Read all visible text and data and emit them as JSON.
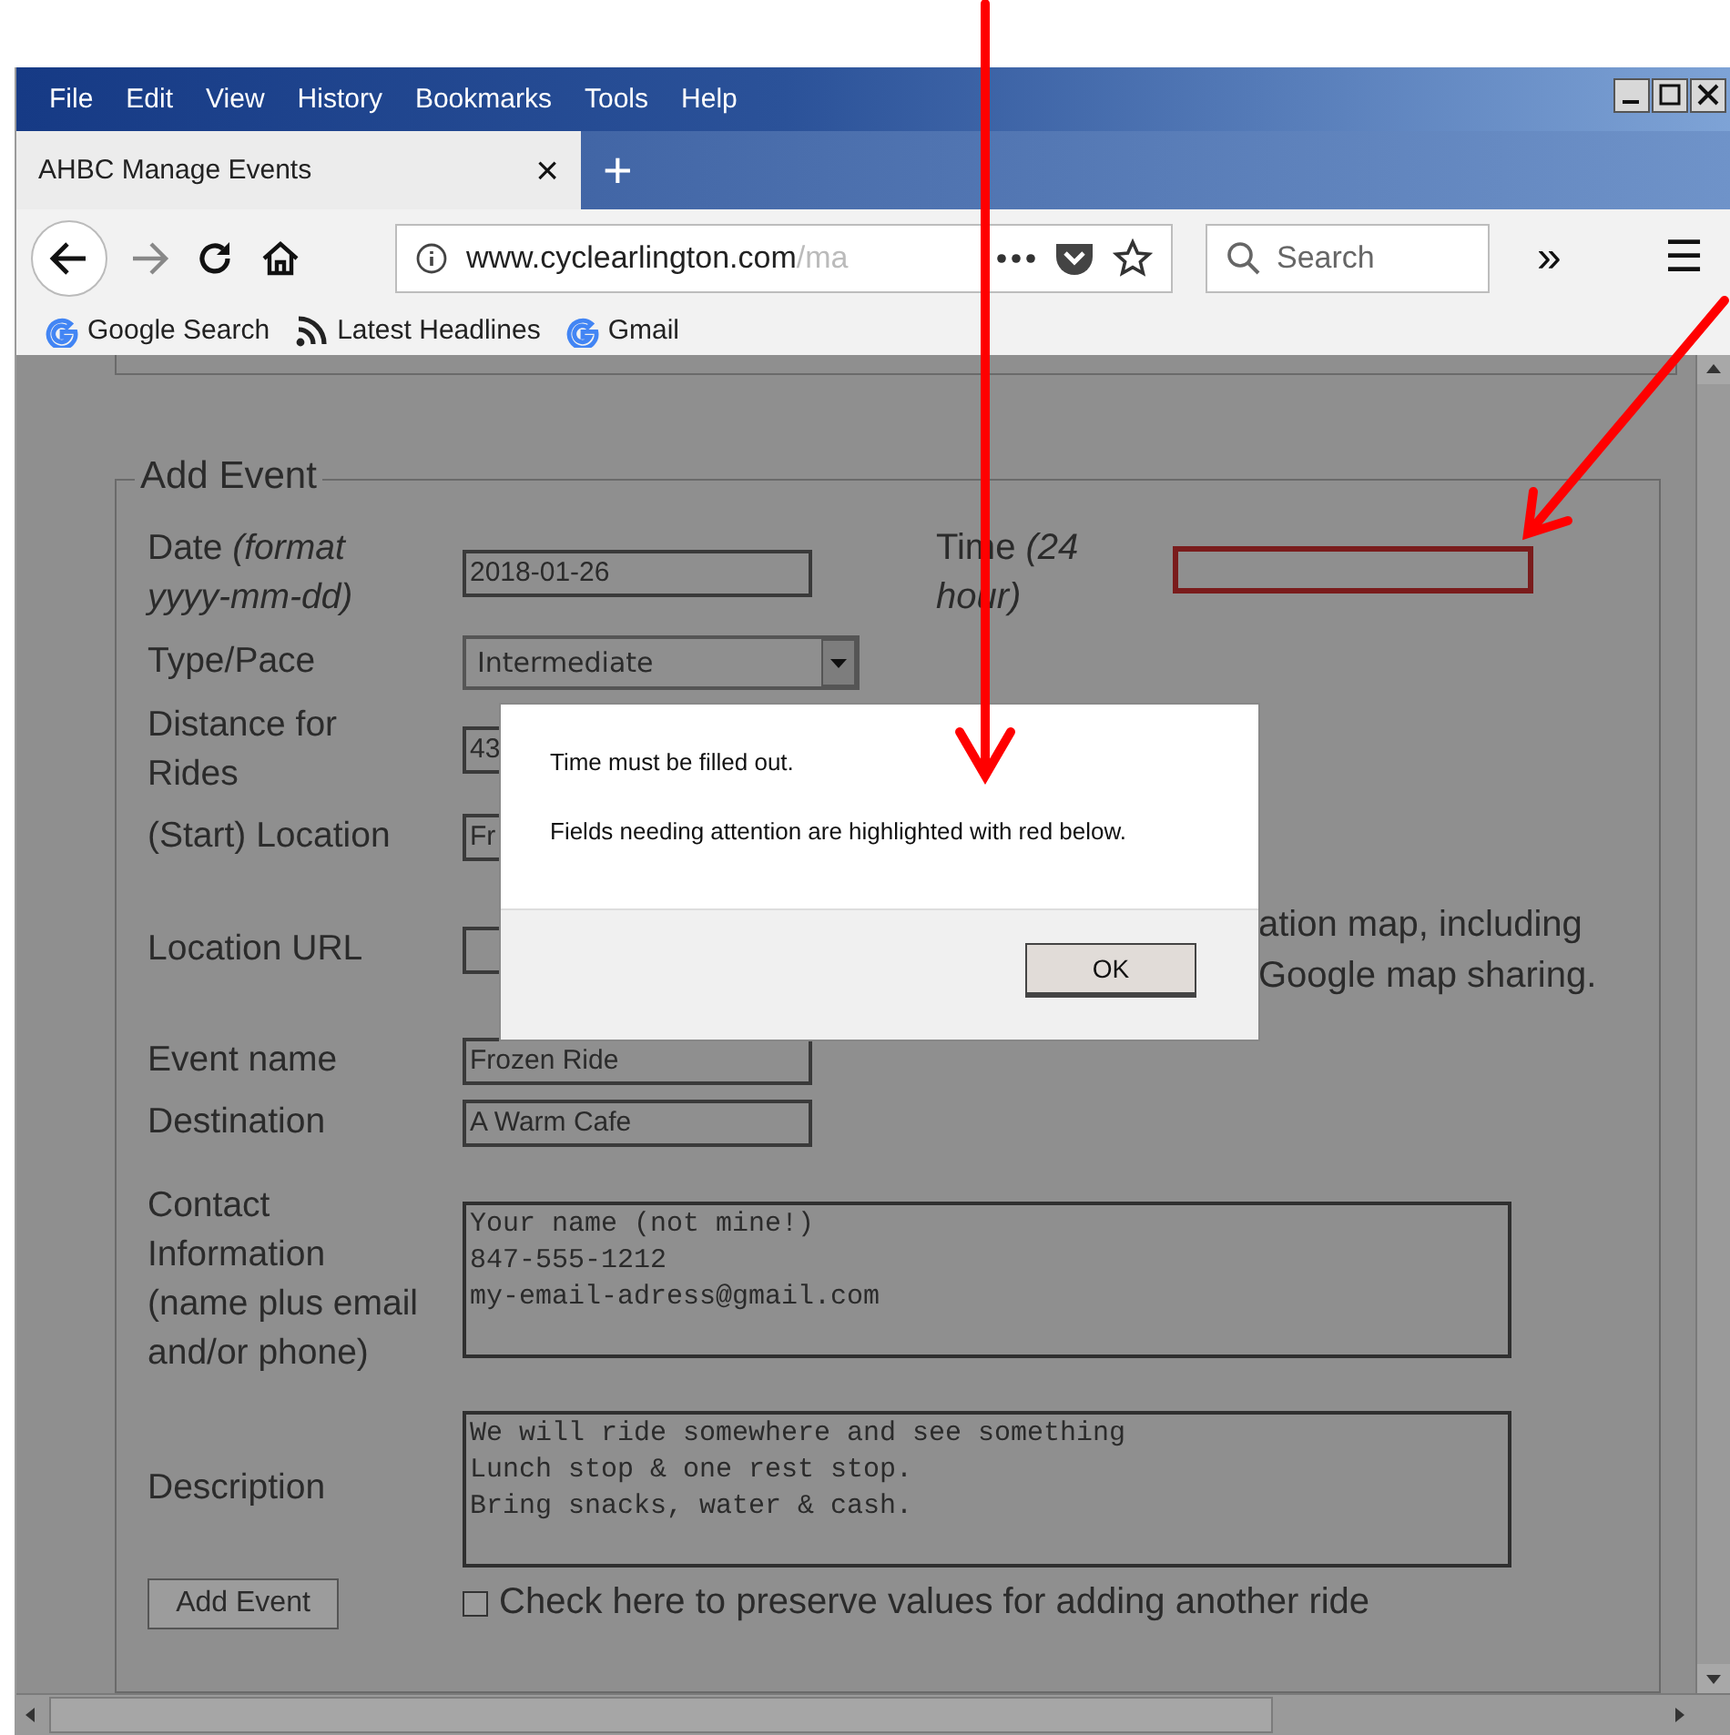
{
  "menu": [
    {
      "label": "File"
    },
    {
      "label": "Edit"
    },
    {
      "label": "View"
    },
    {
      "label": "History"
    },
    {
      "label": "Bookmarks"
    },
    {
      "label": "Tools"
    },
    {
      "label": "Help"
    }
  ],
  "tabs": [
    {
      "title": "AHBC Manage Events",
      "close": "×",
      "selected": true
    }
  ],
  "new_tab": "+",
  "toolbar": {
    "url_domain": "www.cyclearlington.com",
    "url_path": "/ma",
    "search_placeholder": "Search",
    "overflow": "»",
    "menu": "☰"
  },
  "bookmarks": [
    {
      "label": "Google Search",
      "kind": "google"
    },
    {
      "label": "Latest Headlines",
      "kind": "feed"
    },
    {
      "label": "Gmail",
      "kind": "google"
    }
  ],
  "form": {
    "legend": "Add Event",
    "date": {
      "label": "Date *(format yyyy-mm-dd)*",
      "value": "2018-01-26"
    },
    "time": {
      "label": "Time *(24 hour)*",
      "invalid": true
    },
    "type_pace": {
      "label": "Type/Pace",
      "value": "Intermediate"
    },
    "distance": {
      "label": "Distance for Rides",
      "value": "43"
    },
    "location": {
      "label": "(Start) Location",
      "value": "Fr"
    },
    "location_url": {
      "label": "Location URL",
      "hint_lines": [
        "ation map, including",
        "Google map sharing."
      ]
    },
    "event_name": {
      "label": "Event name",
      "value": "Frozen Ride"
    },
    "destination": {
      "label": "Destination",
      "value": "A Warm Cafe"
    },
    "contact": {
      "label": "Contact Information (name plus email and/or phone)",
      "value": "Your name (not mine!)\n847-555-1212\nmy-email-adress@gmail.com"
    },
    "description": {
      "label": "Description",
      "value": "We will ride somewhere and see something\nLunch stop & one rest stop.\nBring snacks, water & cash."
    },
    "submit": "Add Event",
    "preserve": {
      "label": "Check here to preserve values for adding another ride",
      "checked": false
    }
  },
  "dialog": {
    "lines": [
      "Time must be filled out.",
      "Fields needing attention are highlighted with red below."
    ],
    "button": "OK"
  }
}
